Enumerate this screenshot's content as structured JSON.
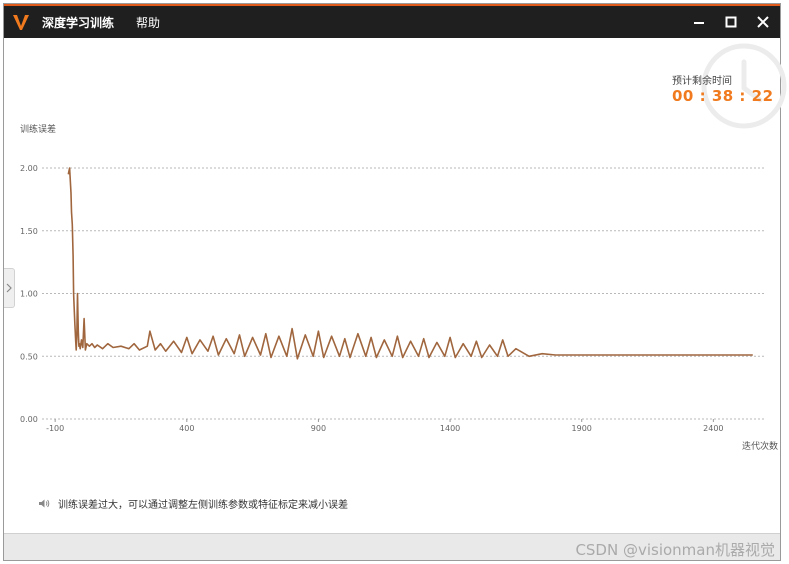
{
  "window": {
    "title": "深度学习训练",
    "menu_help": "帮助",
    "accent_color": "#e05a1b",
    "logo_color": "#f07a1d"
  },
  "eta": {
    "label": "预计剩余时间",
    "value": "00 : 38 : 22",
    "color": "#f07a1d"
  },
  "hint": {
    "text": "训练误差过大，可以通过调整左侧训练参数或特征标定来减小误差"
  },
  "watermark": "CSDN @visionman机器视觉",
  "chart_data": {
    "type": "line",
    "ylabel": "训练误差",
    "xlabel": "迭代次数",
    "xlim": [
      -150,
      2600
    ],
    "ylim": [
      0,
      2.0
    ],
    "xticks": [
      -100,
      400,
      900,
      1400,
      1900,
      2400
    ],
    "xtick_labels": [
      "-100",
      "400",
      "900",
      "1400",
      "1900",
      "2400"
    ],
    "yticks": [
      0,
      0.5,
      1.0,
      1.5,
      2.0
    ],
    "ytick_labels": [
      "0.00",
      "0.50",
      "1.00",
      "1.50",
      "2.00"
    ],
    "grid": "horizontal-dotted",
    "line_color": "#a0663e",
    "series": [
      {
        "x": [
          -50,
          -45,
          -40,
          -38,
          -35,
          -32,
          -30,
          -28,
          -25,
          -22,
          -20,
          -18,
          -15,
          -12,
          -10,
          -8,
          -5,
          0,
          5,
          10,
          15,
          20,
          30,
          40,
          50,
          60,
          80,
          100,
          120,
          150,
          180,
          200,
          220,
          250,
          260,
          280,
          300,
          320,
          350,
          380,
          400,
          420,
          450,
          480,
          500,
          520,
          550,
          580,
          600,
          620,
          650,
          680,
          700,
          720,
          750,
          780,
          800,
          820,
          850,
          880,
          900,
          920,
          950,
          980,
          1000,
          1020,
          1050,
          1080,
          1100,
          1120,
          1150,
          1180,
          1200,
          1220,
          1250,
          1280,
          1300,
          1320,
          1350,
          1380,
          1400,
          1420,
          1450,
          1480,
          1500,
          1520,
          1550,
          1580,
          1600,
          1620,
          1650,
          1700,
          1750,
          1800,
          1900,
          2000,
          2100,
          2200,
          2300,
          2400,
          2500,
          2550
        ],
        "y": [
          1.95,
          2.0,
          1.8,
          1.65,
          1.55,
          1.3,
          1.0,
          0.9,
          0.75,
          0.62,
          0.55,
          0.65,
          1.0,
          0.7,
          0.58,
          0.6,
          0.56,
          0.63,
          0.57,
          0.8,
          0.55,
          0.6,
          0.58,
          0.6,
          0.57,
          0.59,
          0.56,
          0.6,
          0.57,
          0.58,
          0.56,
          0.6,
          0.55,
          0.58,
          0.7,
          0.55,
          0.6,
          0.54,
          0.62,
          0.53,
          0.65,
          0.52,
          0.63,
          0.54,
          0.66,
          0.51,
          0.64,
          0.52,
          0.67,
          0.5,
          0.65,
          0.51,
          0.68,
          0.49,
          0.66,
          0.5,
          0.72,
          0.48,
          0.67,
          0.5,
          0.7,
          0.49,
          0.66,
          0.5,
          0.64,
          0.49,
          0.68,
          0.5,
          0.65,
          0.49,
          0.63,
          0.5,
          0.66,
          0.49,
          0.62,
          0.5,
          0.64,
          0.49,
          0.61,
          0.5,
          0.65,
          0.49,
          0.6,
          0.5,
          0.62,
          0.49,
          0.59,
          0.5,
          0.63,
          0.5,
          0.56,
          0.5,
          0.52,
          0.51,
          0.51,
          0.51,
          0.51,
          0.51,
          0.51,
          0.51,
          0.51,
          0.51
        ]
      }
    ]
  }
}
